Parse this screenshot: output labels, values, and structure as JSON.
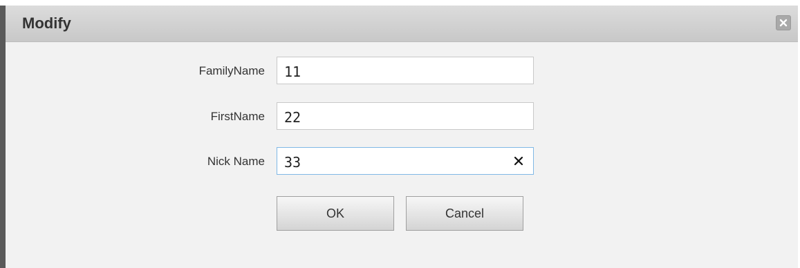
{
  "dialog": {
    "title": "Modify",
    "close_icon": "close-icon"
  },
  "fields": [
    {
      "label": "FamilyName",
      "value": "11"
    },
    {
      "label": "FirstName",
      "value": "22"
    },
    {
      "label": "Nick Name",
      "value": "33",
      "clear_icon": "clear-icon"
    }
  ],
  "buttons": {
    "ok_label": "OK",
    "cancel_label": "Cancel"
  },
  "colors": {
    "titlebar": "#c8c8c8",
    "background": "#f2f2f2",
    "focus_border": "#7fb8e6"
  }
}
